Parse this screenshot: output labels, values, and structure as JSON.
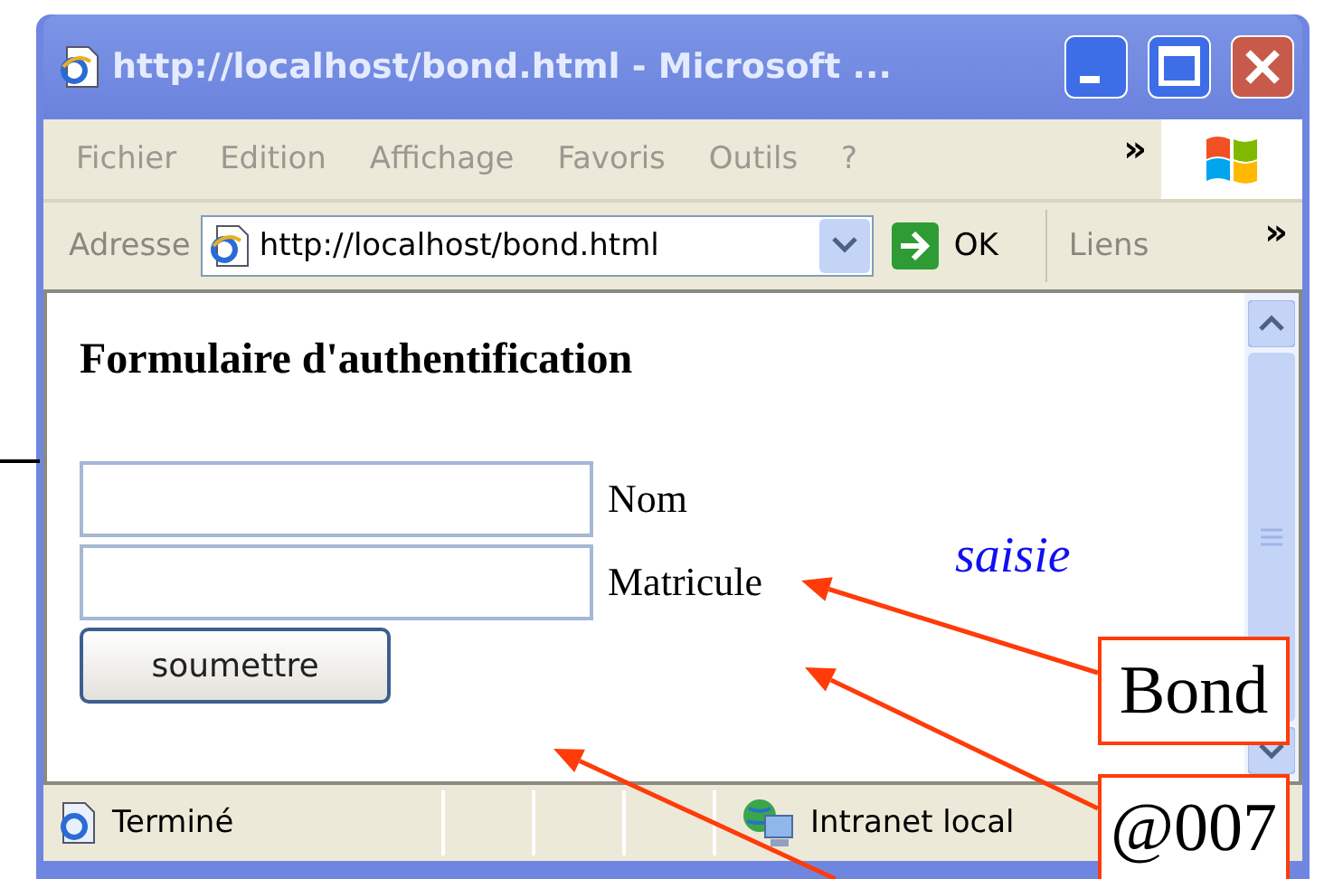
{
  "window": {
    "title": "http://localhost/bond.html - Microsoft ..."
  },
  "menu": {
    "items": [
      "Fichier",
      "Edition",
      "Affichage",
      "Favoris",
      "Outils",
      "?"
    ],
    "more": "»"
  },
  "address_bar": {
    "label": "Adresse",
    "url": "http://localhost/bond.html",
    "go": "OK",
    "links": "Liens",
    "more": "»"
  },
  "page": {
    "heading": "Formulaire d'authentification",
    "fields": [
      {
        "label": "Nom"
      },
      {
        "label": "Matricule"
      }
    ],
    "button": "soumettre"
  },
  "status_bar": {
    "status": "Terminé",
    "zone": "Intranet local"
  },
  "annotations": {
    "note": "saisie",
    "callouts": [
      "Bond",
      "@007"
    ]
  }
}
